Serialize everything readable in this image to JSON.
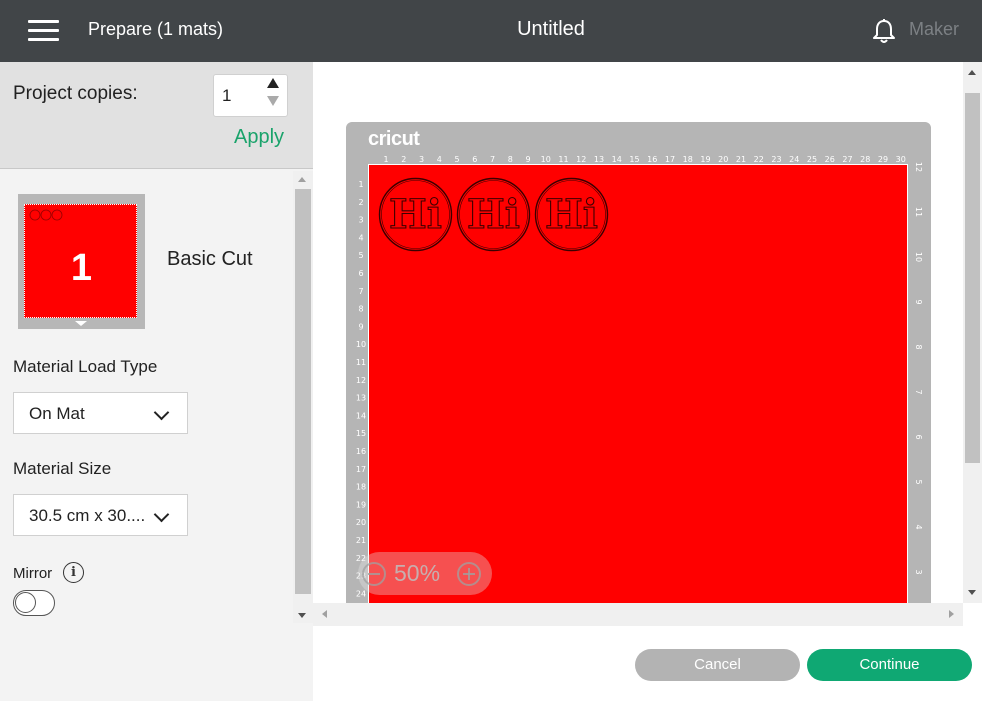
{
  "header": {
    "prepare_title": "Prepare (1 mats)",
    "doc_title": "Untitled",
    "user_label": "Maker"
  },
  "sidebar": {
    "copies_label": "Project copies:",
    "copies_value": "1",
    "apply_label": "Apply",
    "mat": {
      "number": "1",
      "name": "Basic Cut"
    },
    "load_type_label": "Material Load Type",
    "load_type_value": "On Mat",
    "size_label": "Material Size",
    "size_value": "30.5 cm x 30....",
    "mirror_label": "Mirror",
    "mirror_on": false
  },
  "canvas": {
    "brand": "cricut",
    "zoom": "50%",
    "badges": [
      {
        "text": "Hi"
      },
      {
        "text": "Hi"
      },
      {
        "text": "Hi"
      }
    ],
    "ruler_top": [
      "1",
      "2",
      "3",
      "4",
      "5",
      "6",
      "7",
      "8",
      "9",
      "10",
      "11",
      "12",
      "13",
      "14",
      "15",
      "16",
      "17",
      "18",
      "19",
      "20",
      "21",
      "22",
      "23",
      "24",
      "25",
      "26",
      "27",
      "28",
      "29",
      "30"
    ],
    "ruler_left": [
      "1",
      "2",
      "3",
      "4",
      "5",
      "6",
      "7",
      "8",
      "9",
      "10",
      "11",
      "12",
      "13",
      "14",
      "15",
      "16",
      "17",
      "18",
      "19",
      "20",
      "21",
      "22",
      "23",
      "24"
    ],
    "ruler_right": [
      "12",
      "11",
      "10",
      "9",
      "8",
      "7",
      "6",
      "5",
      "4",
      "3"
    ],
    "mat_color": "#ff0000"
  },
  "footer": {
    "cancel_label": "Cancel",
    "continue_label": "Continue"
  },
  "colors": {
    "header_bg": "#414548",
    "accent": "#0fa873",
    "apply": "#1aa36b"
  },
  "icons": [
    "menu-icon",
    "bell-icon",
    "info-icon",
    "zoom-out-icon",
    "zoom-in-icon"
  ]
}
